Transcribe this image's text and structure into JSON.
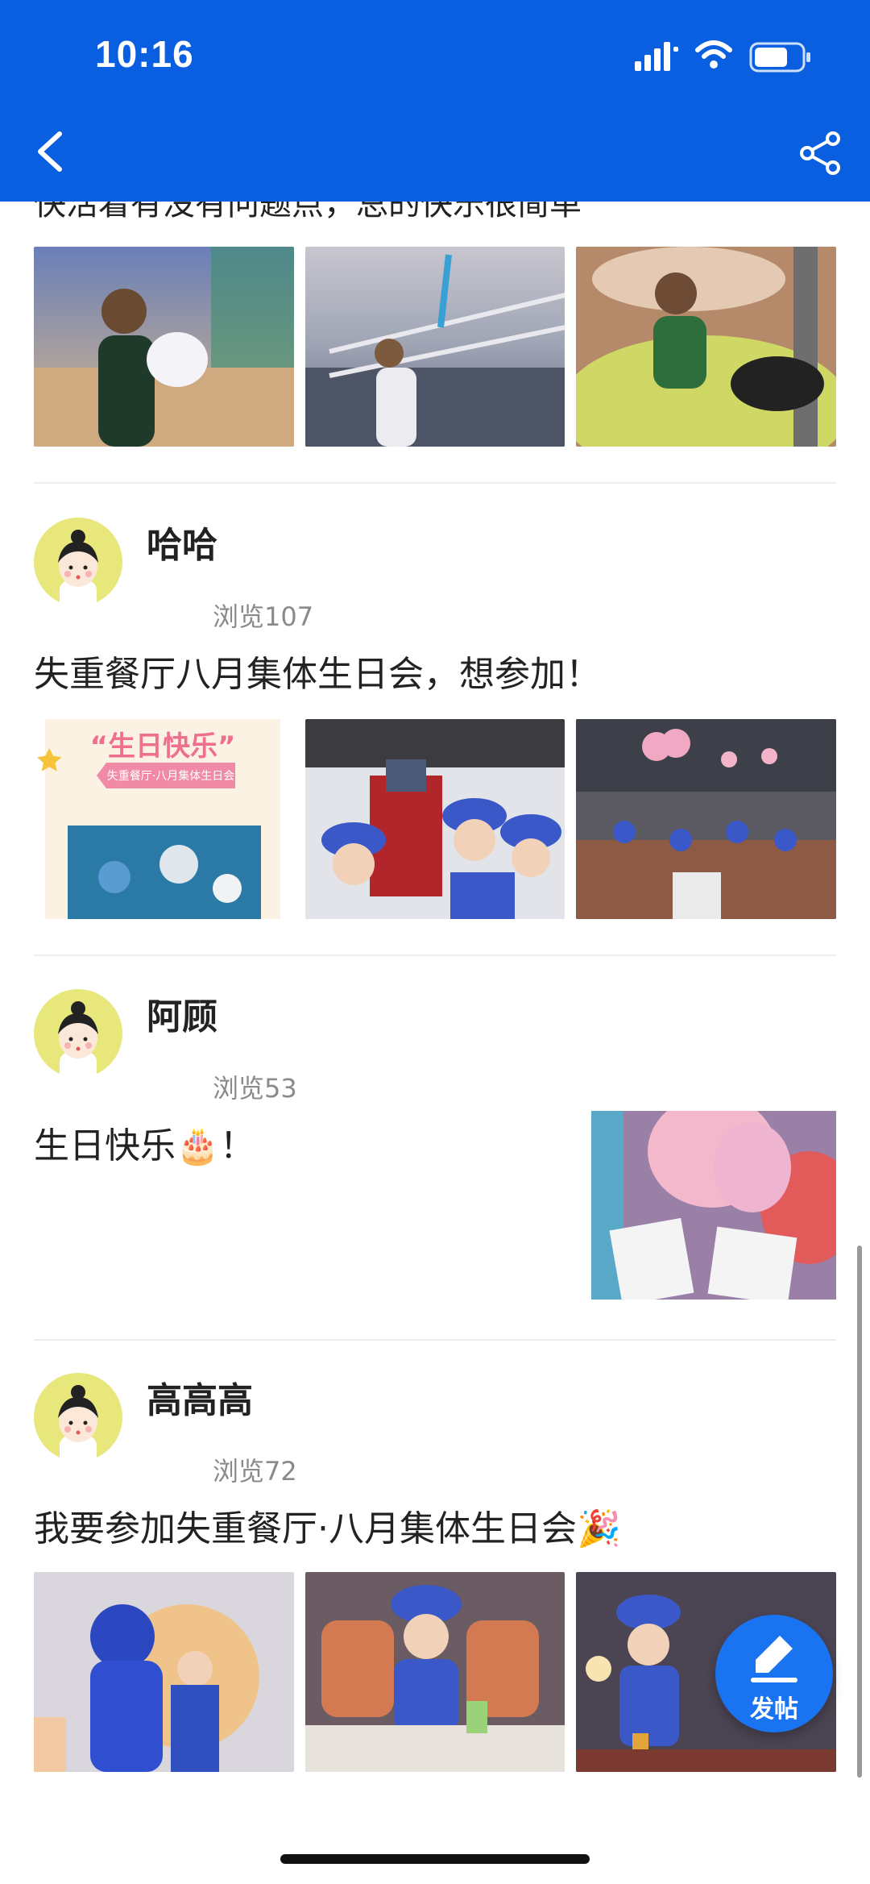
{
  "status_bar": {
    "time": "10:16"
  },
  "nav": {
    "back_icon": "chevron-left-icon",
    "share_icon": "share-icon"
  },
  "partial_post": {
    "text": "快活着有没有问题点，总的快乐很简单"
  },
  "posts": [
    {
      "username": "哈哈",
      "views": "浏览107",
      "text": "失重餐厅八月集体生日会，想参加！",
      "poster_title": "“生日快乐”",
      "poster_subtitle": "失重餐厅·八月集体生日会"
    },
    {
      "username": "阿顾",
      "views": "浏览53",
      "text": "生日快乐🎂！"
    },
    {
      "username": "高高高",
      "views": "浏览72",
      "text": "我要参加失重餐厅·八月集体生日会🎉"
    }
  ],
  "fab": {
    "label": "发帖"
  },
  "colors": {
    "header": "#0a5fe0",
    "fab": "#1a73f0",
    "avatar_bg": "#e7e77c"
  }
}
